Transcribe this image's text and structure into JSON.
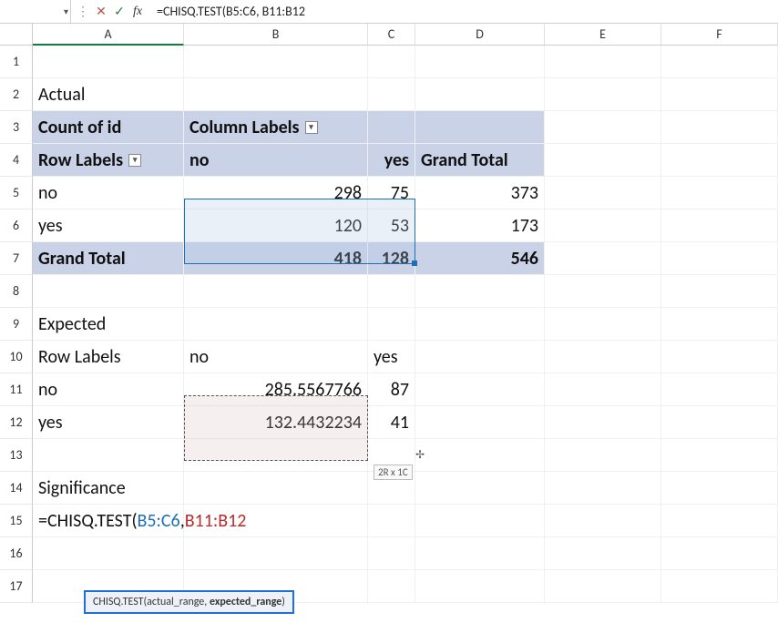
{
  "formula_bar": {
    "name_box": "",
    "text": "=CHISQ.TEST(B5:C6, B11:B12"
  },
  "columns": [
    "A",
    "B",
    "C",
    "D",
    "E",
    "F"
  ],
  "row_numbers": [
    "1",
    "2",
    "3",
    "4",
    "5",
    "6",
    "7",
    "8",
    "9",
    "10",
    "11",
    "12",
    "13",
    "14",
    "15",
    "16",
    "17"
  ],
  "labels": {
    "actual": "Actual",
    "count_of_id": "Count of id",
    "column_labels": "Column Labels",
    "row_labels_1": "Row Labels",
    "no_hdr": "no",
    "yes_hdr": "yes",
    "grand_total_col": "Grand Total",
    "grand_total_row": "Grand Total",
    "expected": "Expected",
    "row_labels_2": "Row Labels",
    "no_hdr2": "no",
    "yes_hdr2": "yes",
    "significance": "Significance"
  },
  "chart_data": {
    "type": "table",
    "actual": {
      "rows": [
        "no",
        "yes"
      ],
      "cols": [
        "no",
        "yes"
      ],
      "values": [
        [
          298,
          75
        ],
        [
          120,
          53
        ]
      ],
      "row_totals": [
        373,
        173
      ],
      "col_totals": [
        418,
        128
      ],
      "grand_total": 546
    },
    "expected": {
      "rows": [
        "no",
        "yes"
      ],
      "cols": [
        "no",
        "yes"
      ],
      "values": [
        [
          285.5567766,
          87
        ],
        [
          132.4432234,
          41
        ]
      ]
    }
  },
  "formula_edit": {
    "prefix": "=CHISQ.TEST(",
    "range1": "B5:C6",
    "comma": ", ",
    "range2": "B11:B12"
  },
  "tooltip": {
    "fn": "CHISQ.TEST(",
    "arg1": "actual_range, ",
    "arg2": "expected_range",
    "close": ")"
  },
  "badge": "2R x 1C"
}
